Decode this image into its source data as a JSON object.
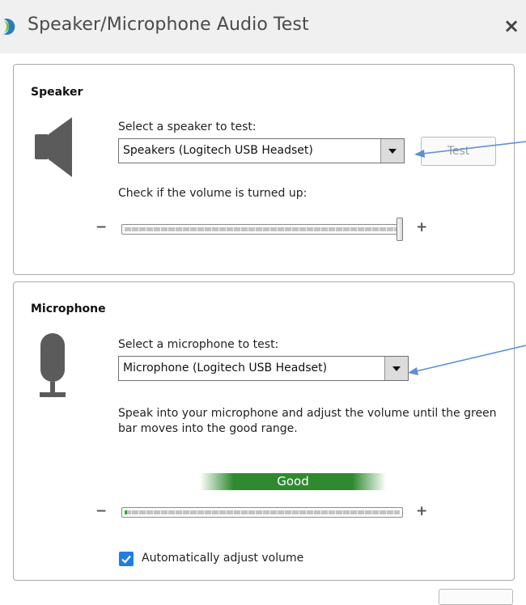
{
  "window": {
    "title": "Speaker/Microphone Audio Test",
    "close_glyph": "×"
  },
  "speaker": {
    "heading": "Speaker",
    "select_label": "Select a speaker to test:",
    "selected_device": "Speakers (Logitech USB Headset)",
    "test_button": "Test",
    "volume_label": "Check if the volume is turned up:",
    "minus": "−",
    "plus": "+",
    "volume_level": 1.0
  },
  "microphone": {
    "heading": "Microphone",
    "select_label": "Select a microphone to test:",
    "selected_device": "Microphone (Logitech USB Headset)",
    "instructions": "Speak into your microphone and adjust the volume until the green bar moves into the good range.",
    "good_range_label": "Good",
    "minus": "−",
    "plus": "+",
    "input_level": 0.01,
    "auto_adjust": {
      "label": "Automatically adjust volume",
      "checked": true
    }
  },
  "icons": {
    "app": "app-logo-icon",
    "close": "close-icon",
    "speaker": "speaker-icon",
    "microphone": "microphone-icon",
    "dropdown": "chevron-down-icon",
    "checkmark": "checkmark-icon"
  },
  "colors": {
    "good_bar": "#2f8a2f",
    "checkbox": "#1f7ee0",
    "annotation_arrow": "#5b8fd6",
    "app_logo": "#2a7fb8"
  }
}
